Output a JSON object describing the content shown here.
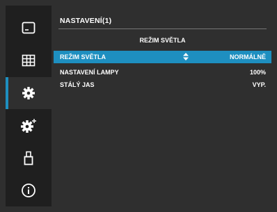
{
  "panel": {
    "title": "NASTAVENÍ(1)",
    "section_header": "REŽIM SVĚTLA",
    "rows": [
      {
        "label": "REŽIM SVĚTLA",
        "value": "NORMÁLNĚ",
        "selected": true
      },
      {
        "label": "NASTAVENÍ LAMPY",
        "value": "100%"
      },
      {
        "label": "STÁLÝ JAS",
        "value": "VYP."
      }
    ]
  },
  "sidebar": {
    "items": [
      {
        "icon": "picture-icon"
      },
      {
        "icon": "grid-icon"
      },
      {
        "icon": "gear-icon",
        "active": true
      },
      {
        "icon": "gear-plus-icon"
      },
      {
        "icon": "usb-icon"
      },
      {
        "icon": "info-icon"
      }
    ]
  },
  "colors": {
    "accent": "#1e8fc0",
    "background": "#2f2f2f",
    "sidebar": "#1f1f1f"
  }
}
